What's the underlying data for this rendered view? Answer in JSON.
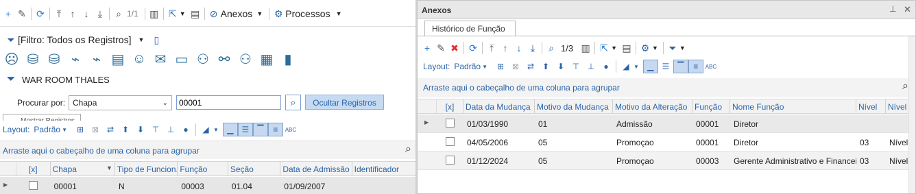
{
  "left": {
    "toolbar": {
      "page": "1/1",
      "anexos": "Anexos",
      "processos": "Processos"
    },
    "filter": {
      "label": "[Filtro: Todos os Registros]"
    },
    "title": "WAR ROOM THALES",
    "search": {
      "label": "Procurar por:",
      "field": "Chapa",
      "value": "00001",
      "hide_button": "Ocultar Registros",
      "partial_button": "Mostrar Registros"
    },
    "layout": {
      "label": "Layout:",
      "preset": "Padrão"
    },
    "group_hint": "Arraste aqui o cabeçalho de uma coluna para agrupar",
    "grid": {
      "headers": [
        "[x]",
        "Chapa",
        "Tipo de Funcion...",
        "Função",
        "Seção",
        "Data de Admissão",
        "Identificador"
      ],
      "rows": [
        [
          "",
          "00001",
          "N",
          "00003",
          "01.04",
          "01/09/2007",
          ""
        ]
      ]
    }
  },
  "right": {
    "panel_title": "Anexos",
    "tab": "Histórico de Função",
    "toolbar": {
      "page": "1/3"
    },
    "layout": {
      "label": "Layout:",
      "preset": "Padrão"
    },
    "group_hint": "Arraste aqui o cabeçalho de uma coluna para agrupar",
    "grid": {
      "headers": [
        "[x]",
        "Data da Mudança",
        "Motivo da Mudança",
        "Motivo da Alteração",
        "Função",
        "Nome Função",
        "Nível",
        "Nível da"
      ],
      "rows": [
        [
          "",
          "01/03/1990",
          "01",
          "Admissão",
          "00001",
          "Diretor",
          "",
          ""
        ],
        [
          "",
          "04/05/2006",
          "05",
          "Promoçao",
          "00001",
          "Diretor",
          "03",
          "Nível I"
        ],
        [
          "",
          "01/12/2024",
          "05",
          "Promoçao",
          "00003",
          "Gerente Administrativo e Financeiro",
          "03",
          "Nível I"
        ]
      ]
    }
  }
}
